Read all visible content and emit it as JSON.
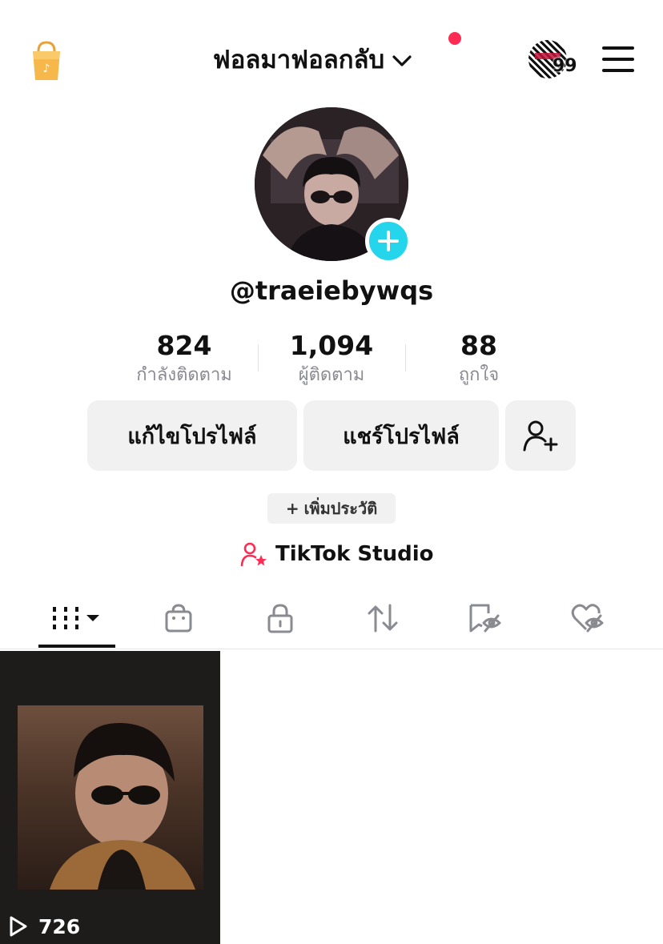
{
  "header": {
    "title": "ฟอลมาฟอลกลับ",
    "notification_count": "99"
  },
  "profile": {
    "username": "@traeiebywqs"
  },
  "stats": [
    {
      "value": "824",
      "label": "กำลังติดตาม"
    },
    {
      "value": "1,094",
      "label": "ผู้ติดตาม"
    },
    {
      "value": "88",
      "label": "ถูกใจ"
    }
  ],
  "actions": {
    "edit_profile": "แก้ไขโปรไฟล์",
    "share_profile": "แชร์โปรไฟล์",
    "add_bio": "เพิ่มประวัติ",
    "add_bio_prefix": "+",
    "studio": "TikTok Studio"
  },
  "tabs": [
    {
      "icon": "videos-grid-icon",
      "selected": true
    },
    {
      "icon": "shop-bag-icon"
    },
    {
      "icon": "lock-icon"
    },
    {
      "icon": "repost-icon"
    },
    {
      "icon": "favorites-hidden-icon"
    },
    {
      "icon": "liked-hidden-icon"
    }
  ],
  "videos": [
    {
      "views": "726"
    }
  ],
  "colors": {
    "accent_red": "#fe2c55",
    "accent_cyan": "#25d5eb",
    "button_bg": "#f1f1f2",
    "muted_text": "#8a8b91"
  }
}
